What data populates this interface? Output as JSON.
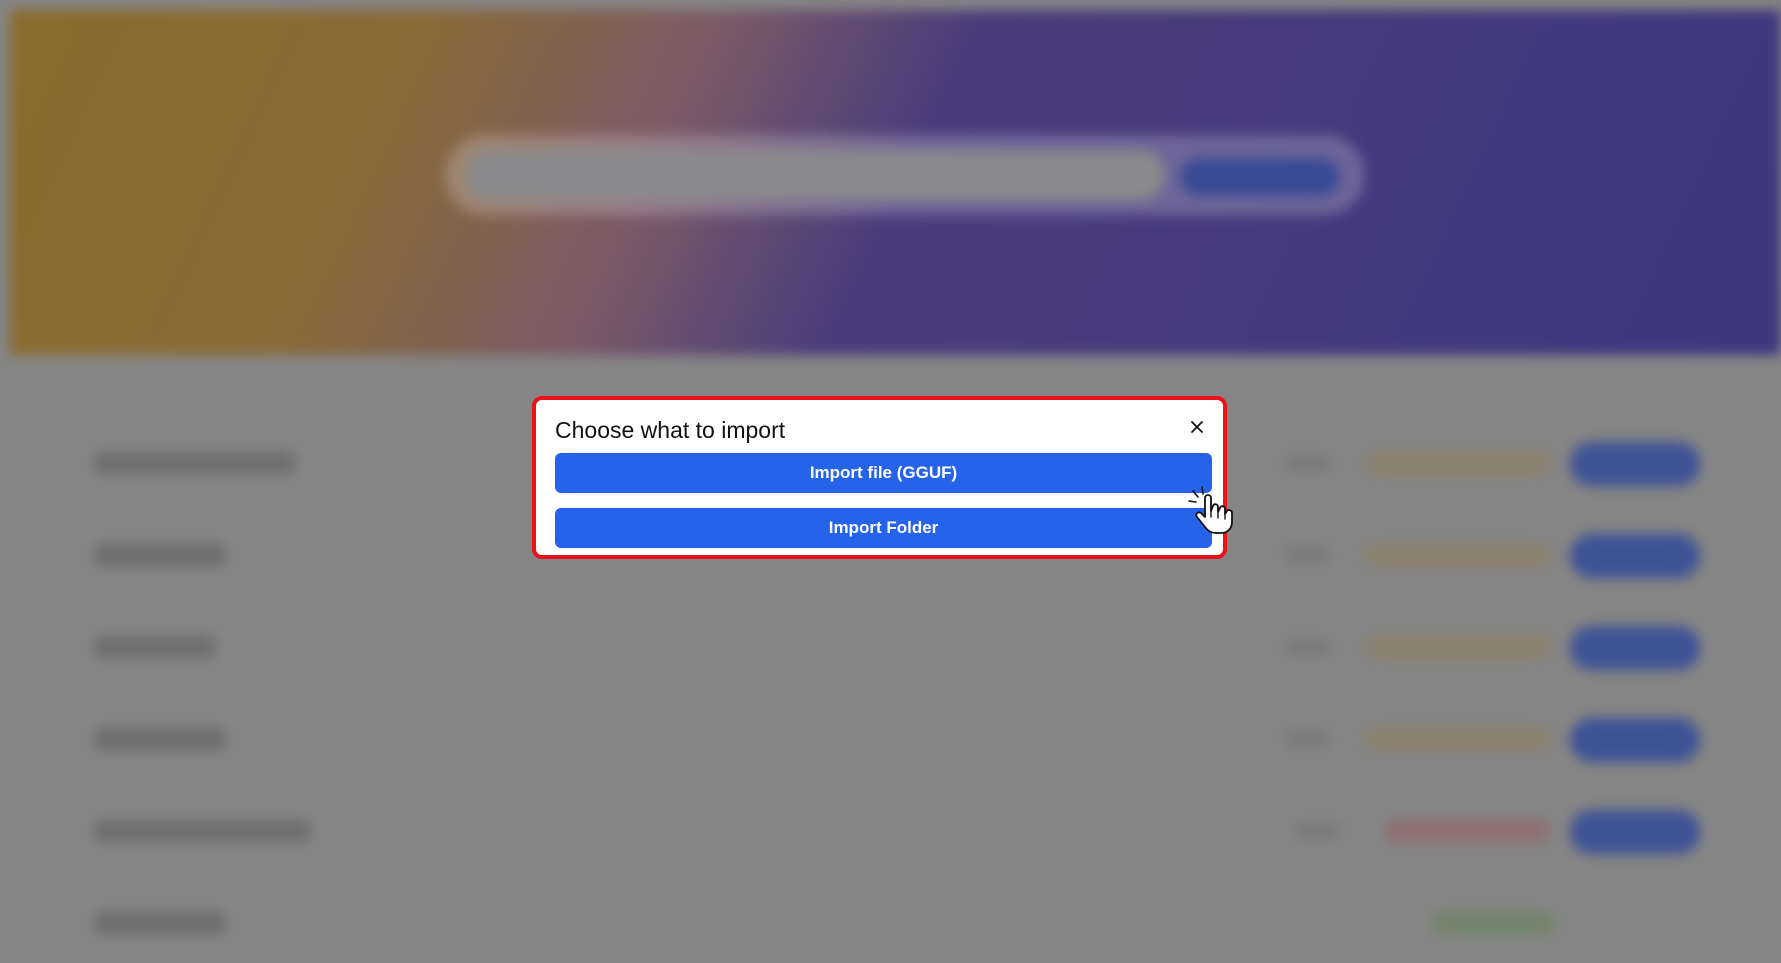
{
  "dialog": {
    "title": "Choose what to import",
    "close_icon": "close-icon",
    "buttons": {
      "import_file": "Import file (GGUF)",
      "import_folder": "Import Folder"
    }
  },
  "cursor": {
    "icon": "pointer-hand-icon"
  },
  "colors": {
    "primary_button": "#2563eb",
    "highlight_border": "#e8131b",
    "overlay": "#858585"
  }
}
